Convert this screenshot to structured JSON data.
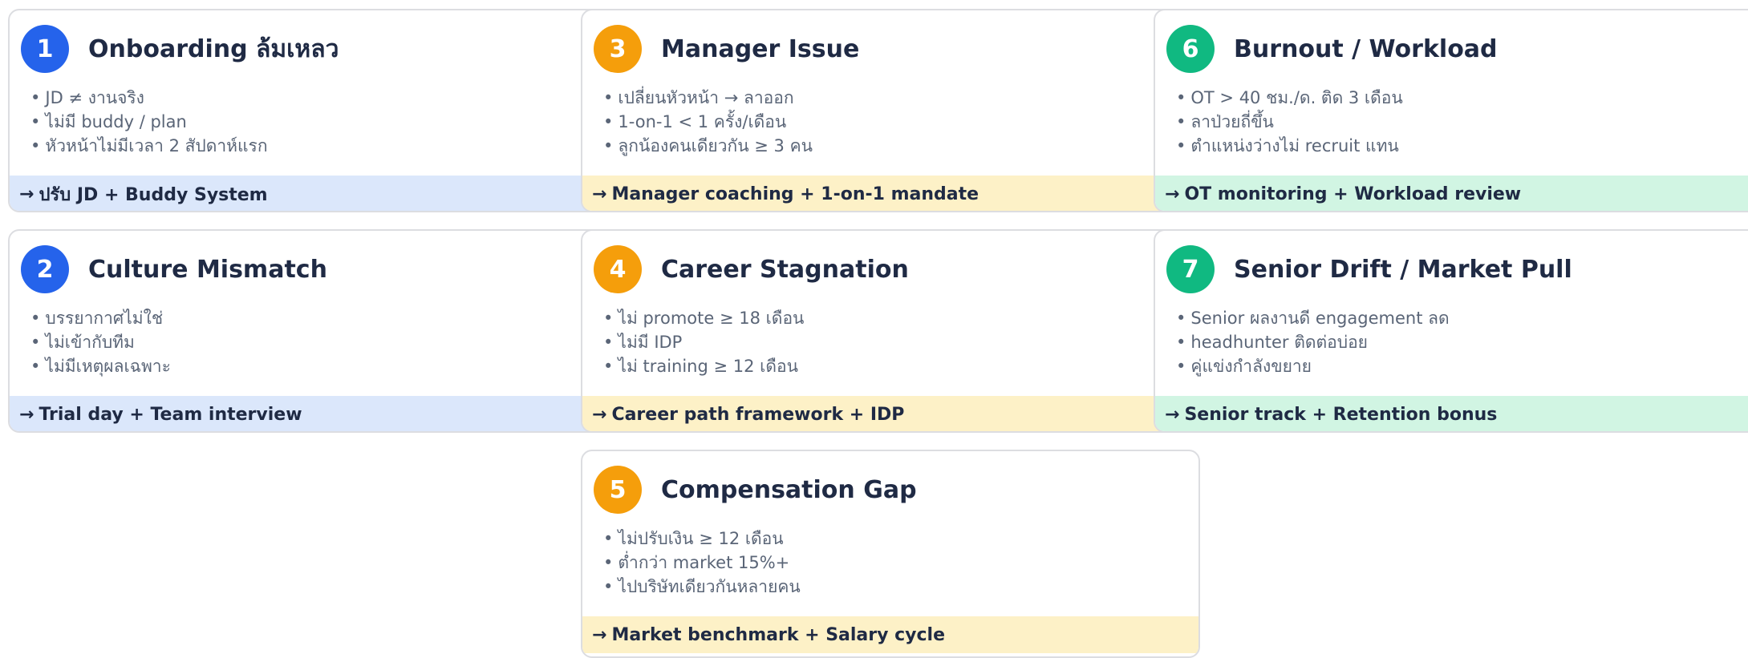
{
  "colors": {
    "blue": "#2563eb",
    "orange": "#f59e0b",
    "green": "#10b981",
    "blue_bg": "#dbe7fb",
    "orange_bg": "#fdf1c7",
    "green_bg": "#d1f5e3"
  },
  "arrow": "→",
  "cards": [
    {
      "num": "1",
      "title": "Onboarding ล้มเหลว",
      "bullets": [
        "JD ≠ งานจริง",
        "ไม่มี buddy / plan",
        "หัวหน้าไม่มีเวลา 2 สัปดาห์แรก"
      ],
      "action": "ปรับ JD + Buddy System"
    },
    {
      "num": "3",
      "title": "Manager Issue",
      "bullets": [
        "เปลี่ยนหัวหน้า → ลาออก",
        "1-on-1 < 1 ครั้ง/เดือน",
        "ลูกน้องคนเดียวกัน ≥ 3 คน"
      ],
      "action": "Manager coaching + 1-on-1 mandate"
    },
    {
      "num": "6",
      "title": "Burnout / Workload",
      "bullets": [
        "OT > 40 ชม./ด. ติด 3 เดือน",
        "ลาป่วยถี่ขึ้น",
        "ตำแหน่งว่างไม่ recruit แทน"
      ],
      "action": "OT monitoring + Workload review"
    },
    {
      "num": "2",
      "title": "Culture Mismatch",
      "bullets": [
        "บรรยากาศไม่ใช่",
        "ไม่เข้ากับทีม",
        "ไม่มีเหตุผลเฉพาะ"
      ],
      "action": "Trial day + Team interview"
    },
    {
      "num": "4",
      "title": "Career Stagnation",
      "bullets": [
        "ไม่ promote ≥ 18 เดือน",
        "ไม่มี IDP",
        "ไม่ training ≥ 12 เดือน"
      ],
      "action": "Career path framework + IDP"
    },
    {
      "num": "7",
      "title": "Senior Drift / Market Pull",
      "bullets": [
        "Senior ผลงานดี engagement ลด",
        "headhunter ติดต่อบ่อย",
        "คู่แข่งกำลังขยาย"
      ],
      "action": "Senior track + Retention bonus"
    },
    {
      "num": "5",
      "title": "Compensation Gap",
      "bullets": [
        "ไม่ปรับเงิน ≥ 12 เดือน",
        "ต่ำกว่า market 15%+",
        "ไปบริษัทเดียวกันหลายคน"
      ],
      "action": "Market benchmark + Salary cycle"
    }
  ]
}
